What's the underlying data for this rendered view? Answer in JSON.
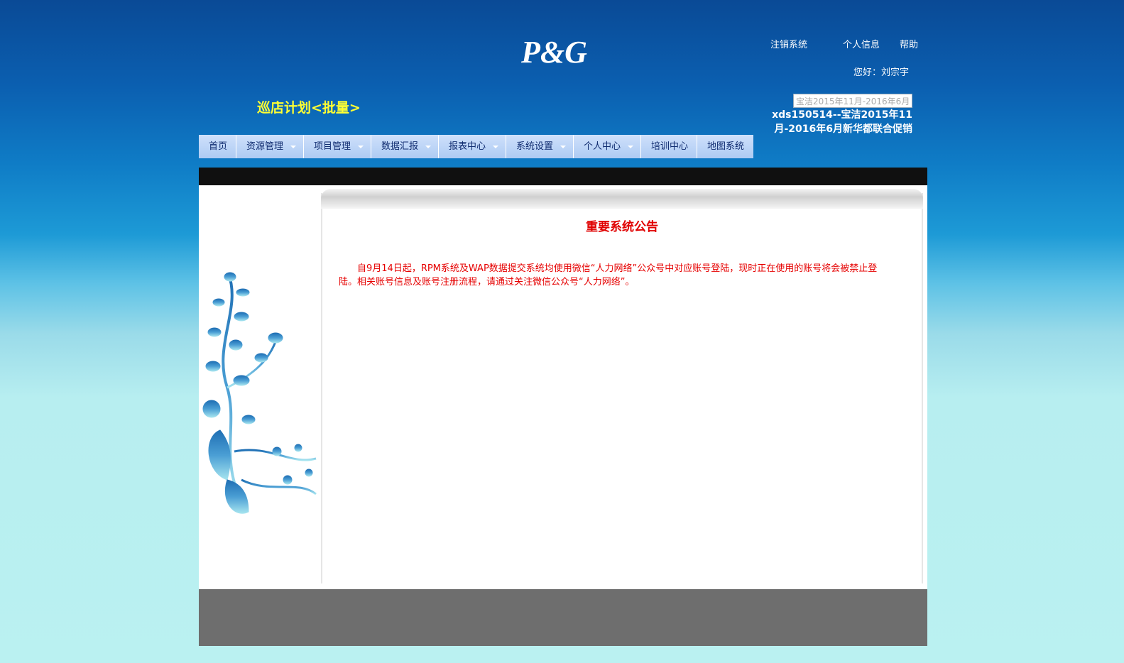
{
  "header": {
    "logo_text": "P&G",
    "links": {
      "logout": "注销系统",
      "profile": "个人信息",
      "help": "帮助"
    },
    "greeting": "您好：刘宗宇",
    "page_title": "巡店计划<批量>",
    "project_select_value": "宝洁2015年11月-2016年6月",
    "project_title": "xds150514--宝洁2015年11月-2016年6月新华都联合促销"
  },
  "nav": {
    "items": [
      {
        "label": "首页",
        "dropdown": false
      },
      {
        "label": "资源管理",
        "dropdown": true
      },
      {
        "label": "项目管理",
        "dropdown": true
      },
      {
        "label": "数据汇报",
        "dropdown": true
      },
      {
        "label": "报表中心",
        "dropdown": true
      },
      {
        "label": "系统设置",
        "dropdown": true
      },
      {
        "label": "个人中心",
        "dropdown": true
      },
      {
        "label": "培训中心",
        "dropdown": false
      },
      {
        "label": "地图系统",
        "dropdown": false
      }
    ]
  },
  "notice": {
    "title": "重要系统公告",
    "body": "自9月14日起，RPM系统及WAP数据提交系统均使用微信“人力网络”公众号中对应账号登陆，现时正在使用的账号将会被禁止登陆。相关账号信息及账号注册流程，请通过关注微信公众号“人力网络”。"
  },
  "colors": {
    "notice_red": "#e60000",
    "title_yellow": "#ffff33",
    "nav_bg": "#b9d3f5",
    "footer_gray": "#6e6e6e"
  }
}
